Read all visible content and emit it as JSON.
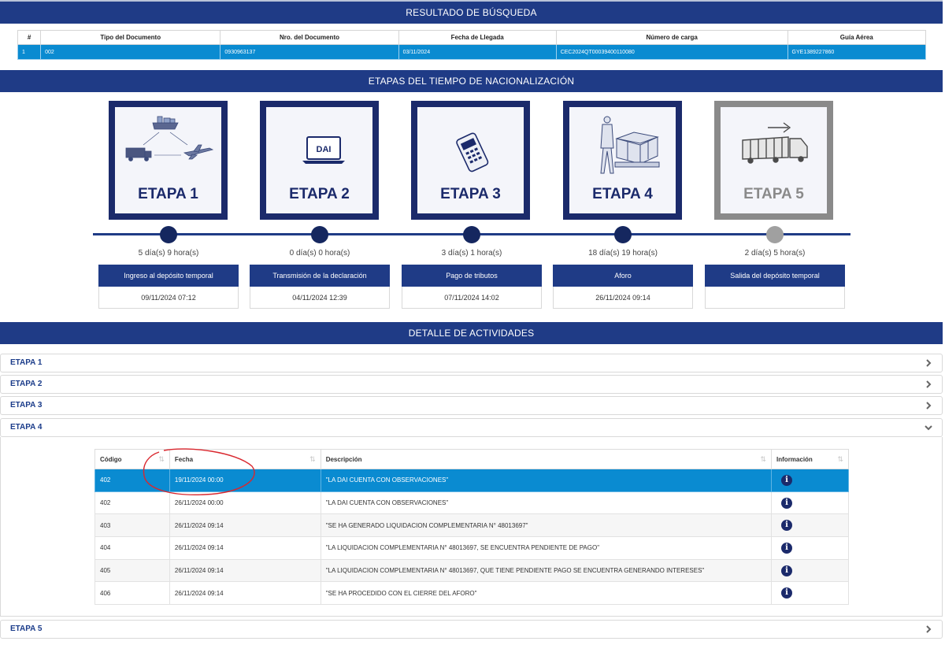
{
  "result": {
    "title": "RESULTADO DE BÚSQUEDA",
    "headers": [
      "#",
      "Tipo del Documento",
      "Nro. del Documento",
      "Fecha de Llegada",
      "Número de carga",
      "Guía Aérea"
    ],
    "row": [
      "1",
      "002",
      "0930963137",
      "03/11/2024",
      "CEC2024QT00039400110080",
      "GYE1389227860"
    ]
  },
  "stages": {
    "title": "ETAPAS DEL TIEMPO DE NACIONALIZACIÓN",
    "items": [
      {
        "label": "ETAPA 1",
        "duration": "5 día(s) 9 hora(s)",
        "name": "Ingreso al depósito temporal",
        "date": "09/11/2024 07:12",
        "status": "done"
      },
      {
        "label": "ETAPA 2",
        "duration": "0 día(s) 0 hora(s)",
        "name": "Transmisión de la declaración",
        "date": "04/11/2024 12:39",
        "status": "done"
      },
      {
        "label": "ETAPA 3",
        "duration": "3 día(s) 1 hora(s)",
        "name": "Pago de tributos",
        "date": "07/11/2024 14:02",
        "status": "done"
      },
      {
        "label": "ETAPA 4",
        "duration": "18 día(s) 19 hora(s)",
        "name": "Aforo",
        "date": "26/11/2024 09:14",
        "status": "done"
      },
      {
        "label": "ETAPA 5",
        "duration": "2 día(s) 5 hora(s)",
        "name": "Salida del depósito temporal",
        "date": "",
        "status": "pending"
      }
    ],
    "dai_text": "DAI"
  },
  "detail": {
    "title": "DETALLE DE ACTIVIDADES",
    "accordions": [
      "ETAPA 1",
      "ETAPA 2",
      "ETAPA 3",
      "ETAPA 4",
      "ETAPA 5"
    ],
    "open": "ETAPA 4",
    "table": {
      "headers": [
        "Código",
        "Fecha",
        "Descripción",
        "Información"
      ],
      "rows": [
        {
          "code": "402",
          "date": "19/11/2024 00:00",
          "desc": "\"LA DAI CUENTA CON OBSERVACIONES\"",
          "selected": true
        },
        {
          "code": "402",
          "date": "26/11/2024 00:00",
          "desc": "\"LA DAI CUENTA CON OBSERVACIONES\"",
          "selected": false
        },
        {
          "code": "403",
          "date": "26/11/2024 09:14",
          "desc": "\"SE HA GENERADO LIQUIDACION COMPLEMENTARIA N° 48013697\"",
          "selected": false
        },
        {
          "code": "404",
          "date": "26/11/2024 09:14",
          "desc": "\"LA LIQUIDACION COMPLEMENTARIA N° 48013697, SE ENCUENTRA PENDIENTE DE PAGO\"",
          "selected": false
        },
        {
          "code": "405",
          "date": "26/11/2024 09:14",
          "desc": "\"LA LIQUIDACION COMPLEMENTARIA N° 48013697, QUE TIENE PENDIENTE PAGO SE ENCUENTRA GENERANDO INTERESES\"",
          "selected": false
        },
        {
          "code": "406",
          "date": "26/11/2024 09:14",
          "desc": "\"SE HA PROCEDIDO CON EL CIERRE DEL AFORO\"",
          "selected": false
        }
      ]
    }
  },
  "colors": {
    "navy": "#1f3b86",
    "selected": "#0a8bd1",
    "annotation": "#d9272e"
  }
}
